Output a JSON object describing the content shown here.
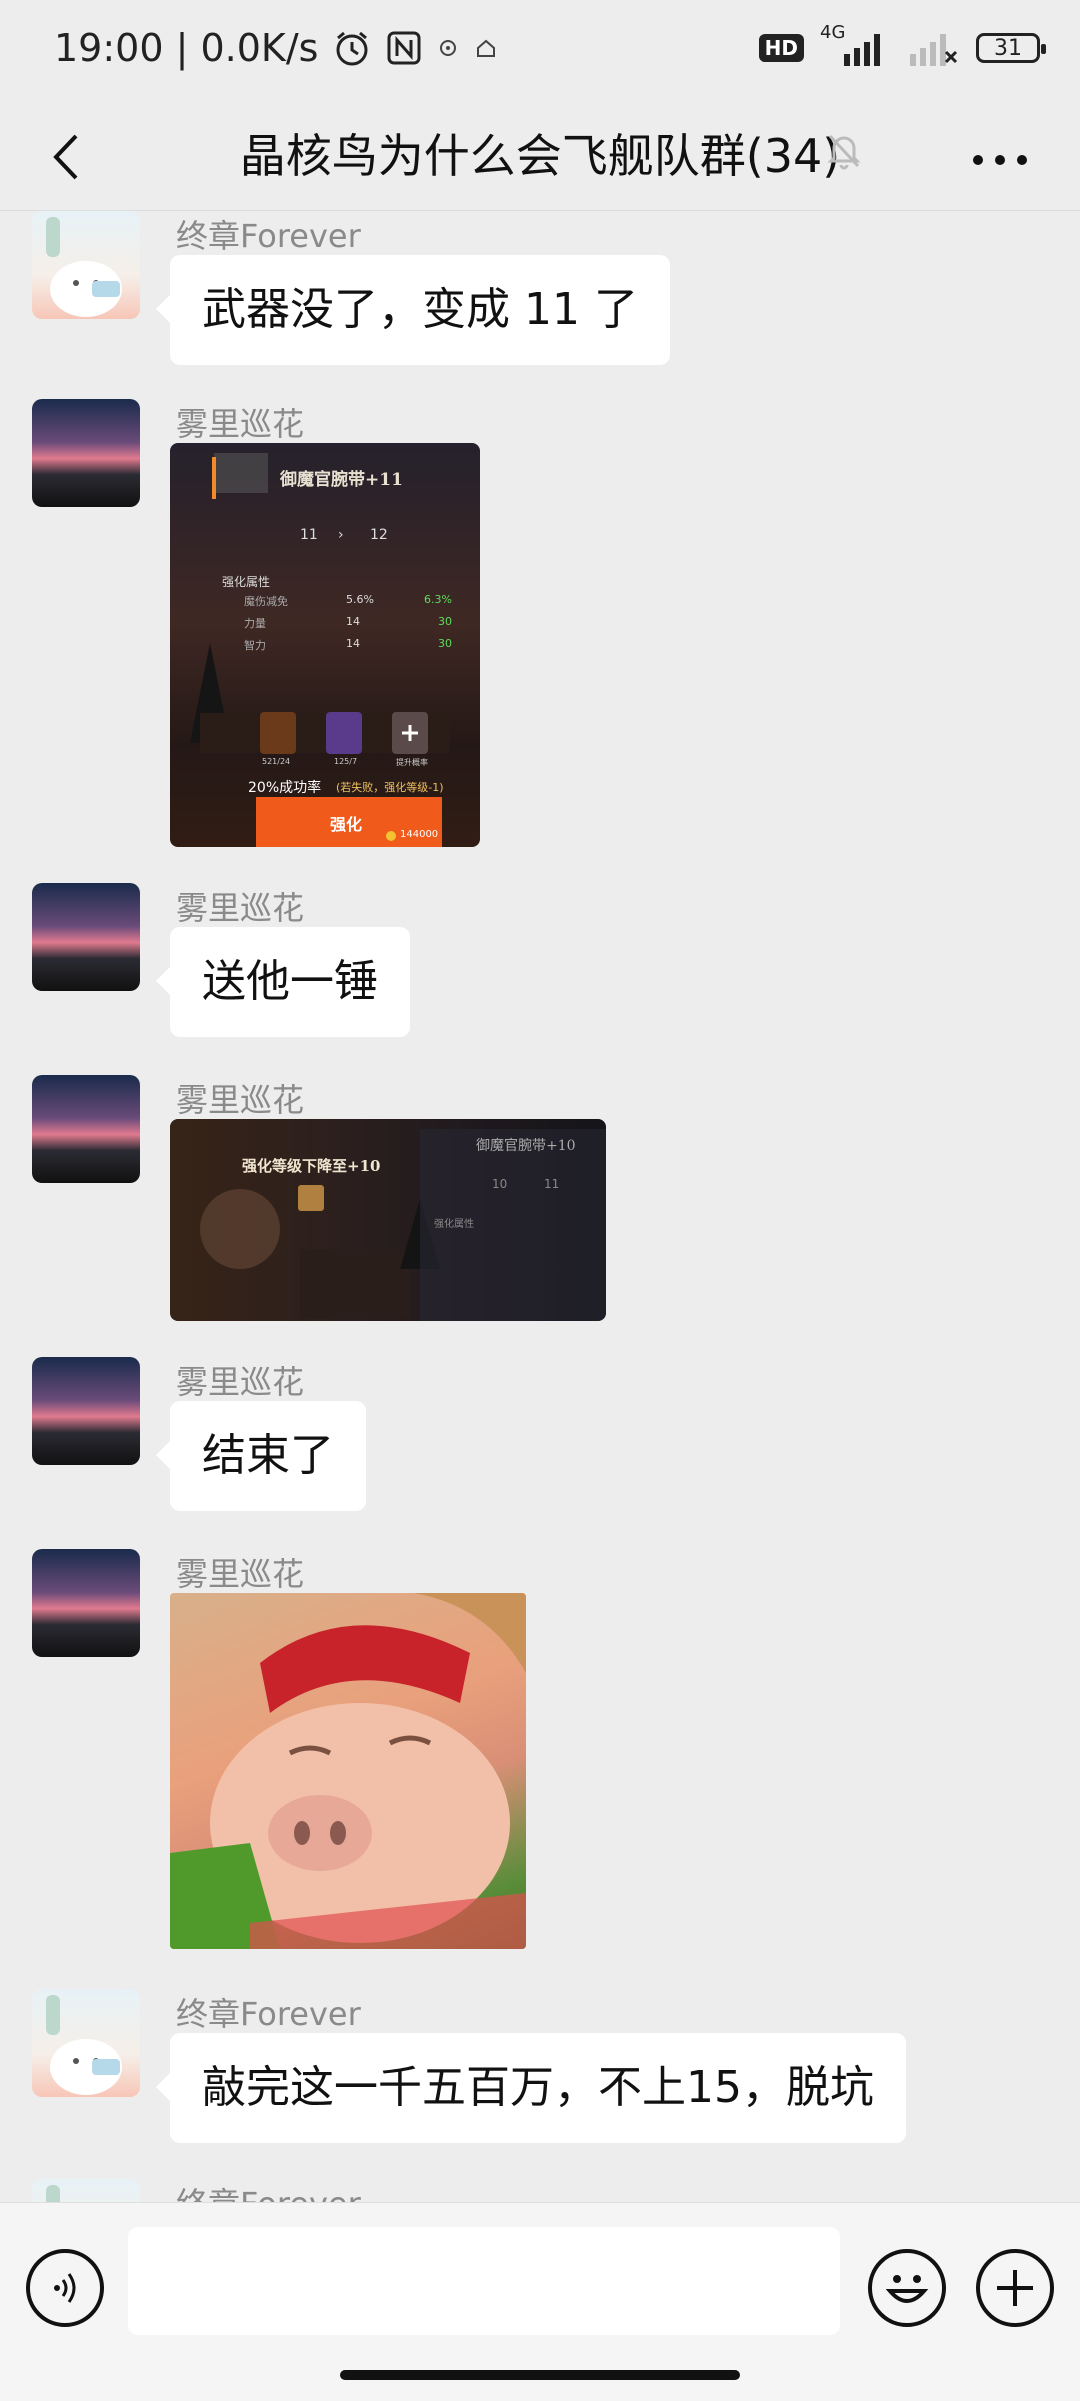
{
  "status_bar": {
    "time_speed": "19:00 | 0.0K/s",
    "hd": "HD",
    "network": "4G",
    "battery": "31",
    "icons": [
      "alarm-icon",
      "nfc-icon",
      "app-icon",
      "home-icon",
      "signal-icon",
      "wifi-icon"
    ]
  },
  "nav": {
    "title": "晶核鸟为什么会飞舰队群(34)",
    "icons": [
      "back-arrow-icon",
      "muted-bell-icon",
      "more-dots-icon"
    ]
  },
  "messages": [
    {
      "sender": "终章Forever",
      "text": "武器没了，变成 11 了"
    },
    {
      "sender": "雾里巡花",
      "image": {
        "item_name": "御魔官腕带+11",
        "level_from": "11",
        "level_to": "12",
        "section": "强化属性",
        "stats": [
          {
            "name": "魔伤减免",
            "from": "5.6%",
            "to": "6.3%"
          },
          {
            "name": "力量",
            "from": "14",
            "to": "30"
          },
          {
            "name": "智力",
            "from": "14",
            "to": "30"
          }
        ],
        "materials": [
          "521/24",
          "125/7",
          "提升概率"
        ],
        "rate": "20%成功率",
        "rate_note": "(若失败，强化等级-1)",
        "button": "强化",
        "cost": "144000"
      }
    },
    {
      "sender": "雾里巡花",
      "text": "送他一锤"
    },
    {
      "sender": "雾里巡花",
      "image": {
        "banner": "强化等级下降至+10",
        "item_name": "御魔官腕带+10",
        "level_from": "10",
        "level_to": "11",
        "section": "强化属性"
      }
    },
    {
      "sender": "雾里巡花",
      "text": "结束了"
    },
    {
      "sender": "雾里巡花",
      "sticker": "pig-face-sticker"
    },
    {
      "sender": "终章Forever",
      "text": "敲完这一千五百万，不上15，脱坑"
    },
    {
      "sender": "终章Forever"
    }
  ],
  "input": {
    "placeholder": "",
    "icons": [
      "voice-icon",
      "emoji-icon",
      "plus-icon"
    ]
  }
}
